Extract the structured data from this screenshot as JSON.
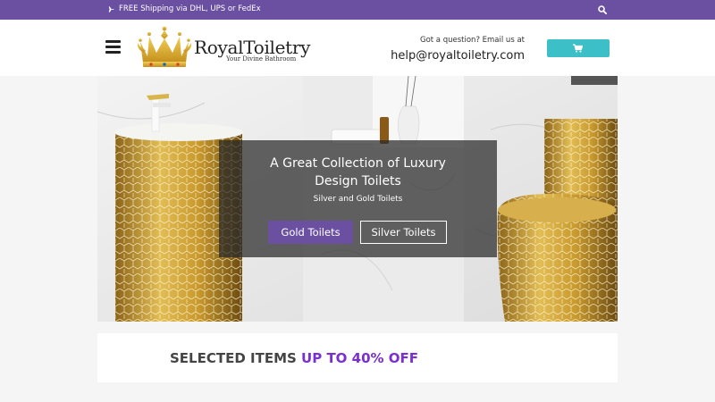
{
  "topbar": {
    "shipping_text": "FREE Shipping via DHL, UPS or FedEx",
    "icons": [
      "plane-icon",
      "search-icon"
    ]
  },
  "header": {
    "brand_name": "RoyalToiletry",
    "brand_tagline": "Your Divine Bathroom",
    "contact_question": "Got a question? Email us at",
    "contact_email": "help@royaltoiletry.com",
    "icons": [
      "hamburger-menu-icon",
      "crown-logo",
      "cart-icon"
    ]
  },
  "hero": {
    "title": "A Great Collection of Luxury Design Toilets",
    "subtitle": "Silver and Gold Toilets",
    "buttons": {
      "gold": "Gold Toilets",
      "silver": "Silver Toilets"
    }
  },
  "promo": {
    "prefix": "SELECTED ITEMS",
    "highlight": "UP TO 40% OFF"
  },
  "colors": {
    "brand_purple": "#6b4fa0",
    "cart_teal": "#3dbfc8",
    "promo_highlight": "#7a2fd0",
    "gold": "#c9a43a"
  }
}
